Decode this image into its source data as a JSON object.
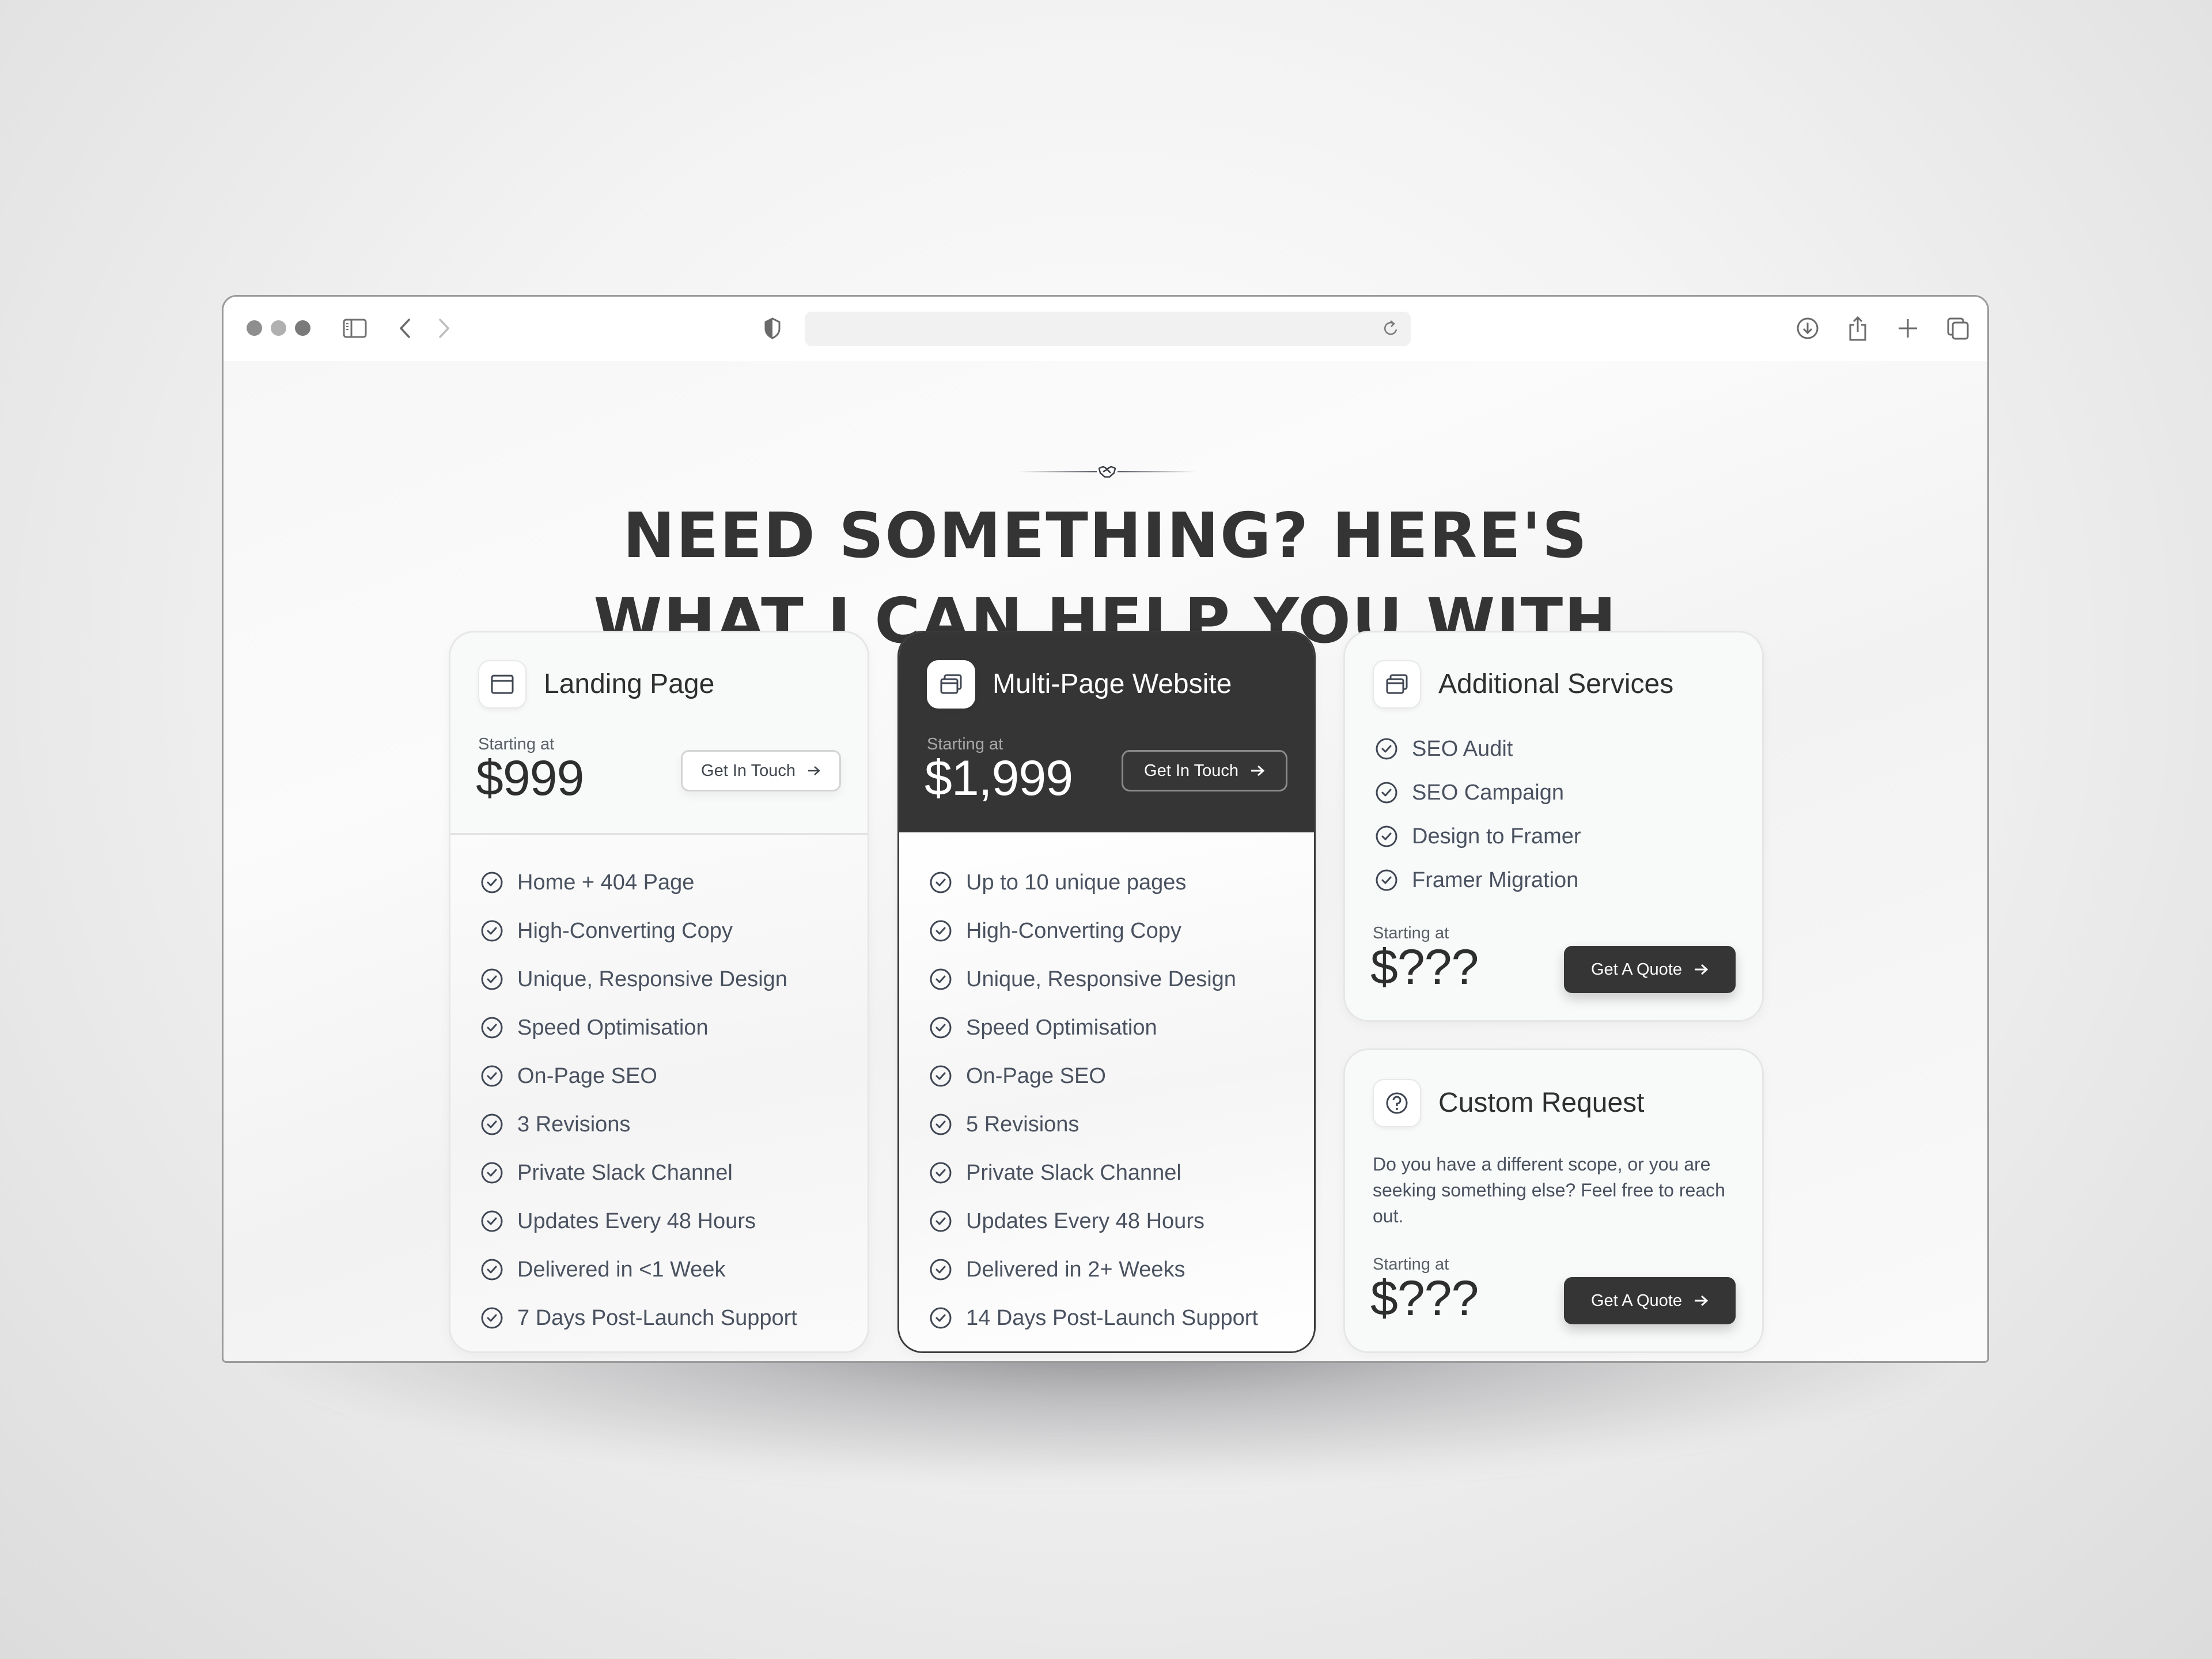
{
  "browser": {
    "window_controls": [
      "close",
      "minimize",
      "zoom"
    ],
    "address_bar": {
      "value": "",
      "placeholder": ""
    },
    "toolbar_icons": [
      "sidebar-icon",
      "back-icon",
      "forward-icon",
      "shield-icon",
      "reload-icon",
      "download-icon",
      "share-icon",
      "new-tab-icon",
      "tabs-overview-icon"
    ]
  },
  "hero": {
    "divider_icon": "handshake-icon",
    "title_line1": "NEED SOMETHING? HERE'S",
    "title_line2": "WHAT I CAN HELP YOU WITH"
  },
  "colors": {
    "dark": "#353535",
    "text": "#333333",
    "muted": "#4a5260",
    "card_bg": "#f8f9f9"
  },
  "cards": [
    {
      "id": "landing-page",
      "icon": "browser-window-icon",
      "title": "Landing Page",
      "starting_label": "Starting at",
      "price": "$999",
      "button_label": "Get In Touch",
      "features": [
        "Home + 404 Page",
        "High-Converting Copy",
        "Unique, Responsive Design",
        "Speed Optimisation",
        "On-Page SEO",
        "3 Revisions",
        "Private Slack Channel",
        "Updates Every 48 Hours",
        "Delivered in <1 Week",
        "7 Days Post-Launch Support"
      ]
    },
    {
      "id": "multi-page-website",
      "icon": "stacked-windows-icon",
      "title": "Multi-Page Website",
      "starting_label": "Starting at",
      "price": "$1,999",
      "button_label": "Get In Touch",
      "featured": true,
      "features": [
        "Up to 10 unique pages",
        "High-Converting Copy",
        "Unique, Responsive Design",
        "Speed Optimisation",
        "On-Page SEO",
        "5 Revisions",
        "Private Slack Channel",
        "Updates Every 48 Hours",
        "Delivered in 2+ Weeks",
        " 14 Days Post-Launch Support"
      ]
    },
    {
      "id": "additional-services",
      "icon": "stacked-windows-icon",
      "title": "Additional Services",
      "features": [
        "SEO Audit",
        "SEO Campaign",
        "Design to Framer",
        "Framer Migration"
      ],
      "starting_label": "Starting at",
      "price": "$???",
      "button_label": "Get A Quote"
    },
    {
      "id": "custom-request",
      "icon": "question-circle-icon",
      "title": "Custom Request",
      "description": "Do you have a different scope, or you are seeking something else? Feel free to reach out.",
      "starting_label": "Starting at",
      "price": "$???",
      "button_label": "Get A Quote"
    }
  ]
}
